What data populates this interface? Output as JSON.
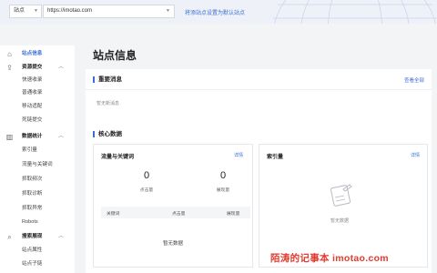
{
  "topbar": {
    "site_select": "站点",
    "url_value": "https://imotao.com",
    "add_site_link": "将添站点设置为默认站点"
  },
  "sidebar": {
    "items": [
      {
        "label": "站点信息",
        "icon": "home-icon"
      },
      {
        "label": "资源提交",
        "icon": "upload-icon"
      },
      {
        "label": "快速收录"
      },
      {
        "label": "普通收录"
      },
      {
        "label": "移动适配"
      },
      {
        "label": "死链提交"
      },
      {
        "label": "数据统计",
        "icon": "chart-icon"
      },
      {
        "label": "索引量"
      },
      {
        "label": "流量与关键词"
      },
      {
        "label": "抓取频次"
      },
      {
        "label": "抓取诊断"
      },
      {
        "label": "抓取异常"
      },
      {
        "label": "Robots"
      },
      {
        "label": "搜索展现",
        "icon": "search-icon"
      },
      {
        "label": "站点属性"
      },
      {
        "label": "站点子链"
      }
    ]
  },
  "main": {
    "page_title": "站点信息",
    "important_messages": {
      "title": "重要消息",
      "view_all": "查看全部",
      "empty": "暂无新消息"
    },
    "core_data": {
      "title": "核心数据",
      "traffic_card": {
        "title": "流量与关键词",
        "detail": "详情",
        "clicks_value": "0",
        "clicks_label": "点击量",
        "impressions_value": "0",
        "impressions_label": "展现量",
        "table_headers": [
          "关键词",
          "点击量",
          "展现量"
        ],
        "table_empty": "暂无数据"
      },
      "index_card": {
        "title": "索引量",
        "detail": "详情",
        "empty": "暂无数据"
      }
    }
  },
  "watermark": "陌涛的记事本 imotao.com",
  "colors": {
    "accent": "#3b6fd6",
    "watermark": "#e23b2e"
  }
}
